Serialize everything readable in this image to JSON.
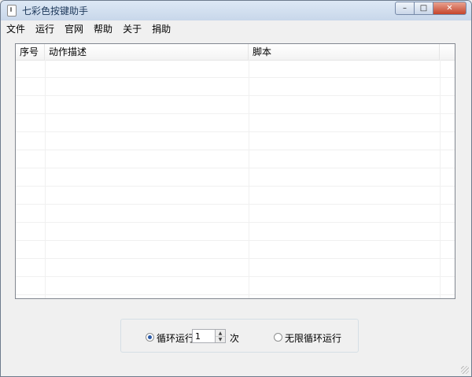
{
  "window": {
    "title": "七彩色按键助手"
  },
  "caption_buttons": {
    "minimize": "–",
    "maximize": "□",
    "close": "✕"
  },
  "menu": [
    "文件",
    "运行",
    "官网",
    "帮助",
    "关于",
    "捐助"
  ],
  "table": {
    "columns": [
      "序号",
      "动作描述",
      "脚本"
    ],
    "rows": []
  },
  "loop_options": {
    "loop_label": "循环运行",
    "loop_selected": true,
    "loop_count": "1",
    "times_label": "次",
    "infinite_label": "无限循环运行",
    "infinite_selected": false
  },
  "icons": {
    "app": "app-icon",
    "spin_up": "up-arrow-icon",
    "spin_down": "down-arrow-icon",
    "resize": "resize-grip-icon"
  }
}
